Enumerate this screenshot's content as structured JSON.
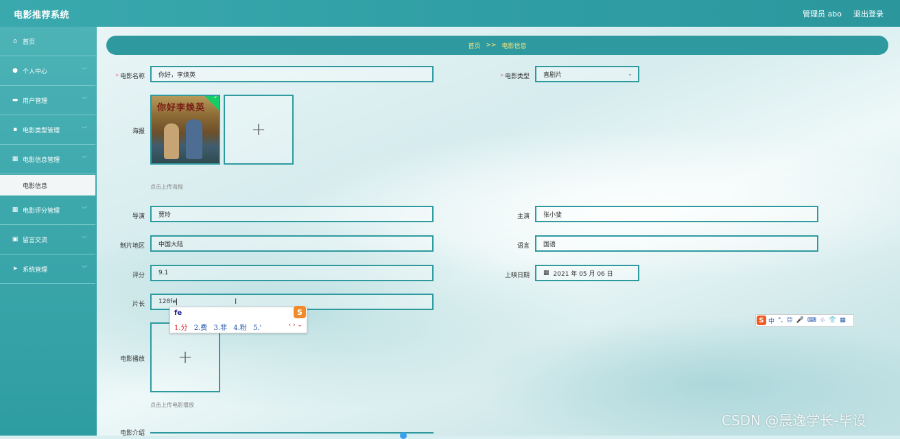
{
  "header": {
    "app_title": "电影推荐系统",
    "admin_label": "管理员 abo",
    "logout_label": "退出登录"
  },
  "sidebar": {
    "items": [
      {
        "icon": "home-icon",
        "glyph": "⌂",
        "label": "首页",
        "has_chevron": false
      },
      {
        "icon": "user-icon",
        "glyph": "●",
        "label": "个人中心",
        "has_chevron": true
      },
      {
        "icon": "monitor-icon",
        "glyph": "▬",
        "label": "用户管理",
        "has_chevron": true
      },
      {
        "icon": "chat-icon",
        "glyph": "▪",
        "label": "电影类型管理",
        "has_chevron": true
      },
      {
        "icon": "grid-icon",
        "glyph": "▦",
        "label": "电影信息管理",
        "has_chevron": true
      },
      {
        "icon": "grid-icon",
        "glyph": "▦",
        "label": "电影评分管理",
        "has_chevron": true
      },
      {
        "icon": "book-icon",
        "glyph": "▣",
        "label": "留言交流",
        "has_chevron": true
      },
      {
        "icon": "send-icon",
        "glyph": "➤",
        "label": "系统管理",
        "has_chevron": true
      }
    ],
    "sub_item": "电影信息"
  },
  "breadcrumb": {
    "home": "首页",
    "separator": ">>",
    "current": "电影信息"
  },
  "form": {
    "movie_name": {
      "label": "电影名称",
      "value": "你好，李焕英"
    },
    "movie_type": {
      "label": "电影类型",
      "value": "喜剧片"
    },
    "poster": {
      "label": "海报",
      "hint": "点击上传海报",
      "poster_title": "你好李焕英"
    },
    "director": {
      "label": "导演",
      "value": "贾玲"
    },
    "lead_actor": {
      "label": "主演",
      "value": "张小斐"
    },
    "region": {
      "label": "制片地区",
      "value": "中国大陆"
    },
    "language": {
      "label": "语言",
      "value": "国语"
    },
    "rating": {
      "label": "评分",
      "value": "9.1"
    },
    "release_date": {
      "label": "上映日期",
      "value": "2021 年 05 月 06 日"
    },
    "duration": {
      "label": "片长",
      "value": "128fe"
    },
    "playback": {
      "label": "电影播放",
      "hint": "点击上传电影播放"
    },
    "intro": {
      "label": "电影介绍"
    }
  },
  "ime_popup": {
    "input": "fe",
    "candidates": [
      "1.分",
      "2.费",
      "3.非",
      "4.粉",
      "5.'"
    ],
    "logo": "S",
    "nav": "‹ › ⌄"
  },
  "ime_toolbar": {
    "logo": "S",
    "items": [
      "中",
      "°,",
      "☺",
      "🎤",
      "⌨",
      "♧",
      "👕",
      "▦"
    ]
  },
  "watermark": "CSDN @晨逸学长-毕设",
  "colors": {
    "accent": "#2e9aa0",
    "breadcrumb_text": "#ffe67a",
    "required": "#f56c6c",
    "success": "#13ce66"
  }
}
